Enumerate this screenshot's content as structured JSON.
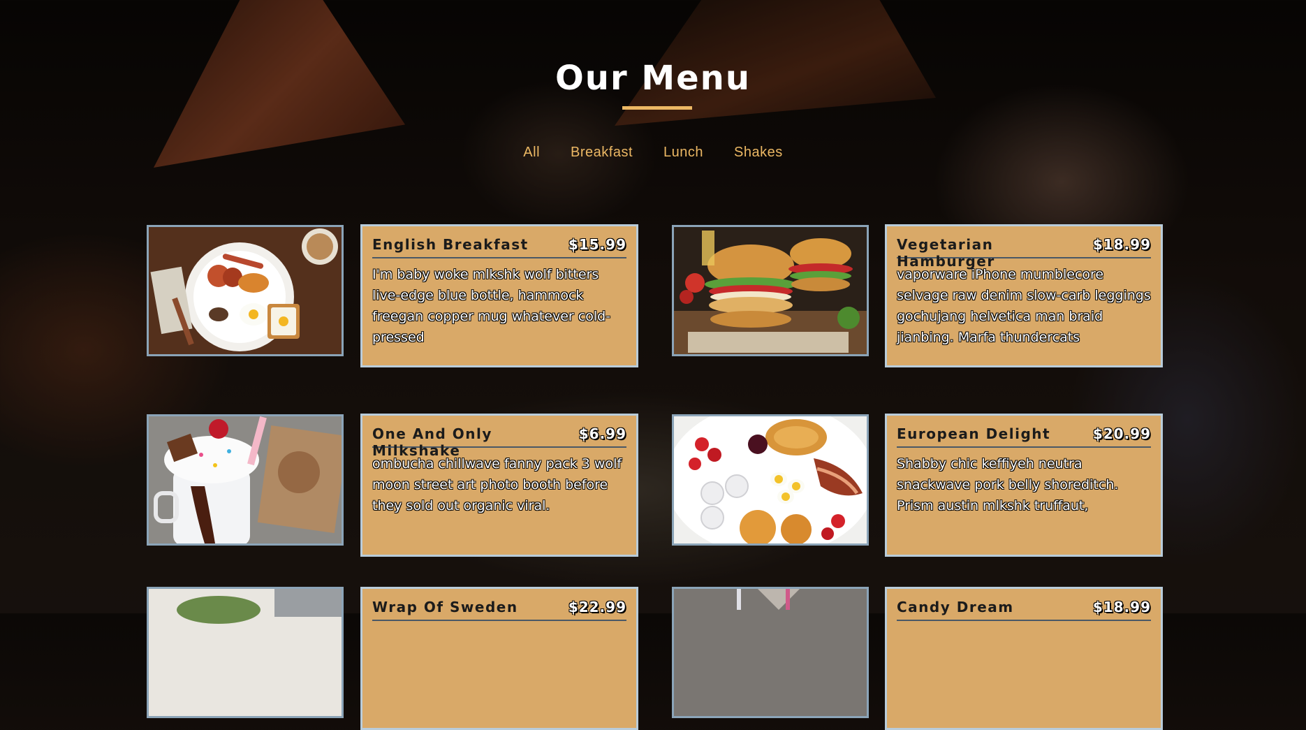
{
  "page": {
    "title": "Our Menu",
    "accent_color": "#ecb864",
    "card_color": "#d9a968"
  },
  "filters": [
    {
      "label": "All"
    },
    {
      "label": "Breakfast"
    },
    {
      "label": "Lunch"
    },
    {
      "label": "Shakes"
    }
  ],
  "items": [
    {
      "name": "English Breakfast",
      "price": "$15.99",
      "desc": "I'm baby woke mlkshk wolf bitters live-edge blue bottle, hammock freegan copper mug whatever cold-pressed",
      "image": "english-breakfast-photo"
    },
    {
      "name": "Vegetarian Hamburger",
      "price": "$18.99",
      "desc": "vaporware iPhone mumblecore selvage raw denim slow-carb leggings gochujang helvetica man braid jianbing. Marfa thundercats",
      "image": "hamburger-photo"
    },
    {
      "name": "One And Only Milkshake",
      "price": "$6.99",
      "desc": "ombucha chillwave fanny pack 3 wolf moon street art photo booth before they sold out organic viral.",
      "image": "milkshake-photo"
    },
    {
      "name": "European Delight",
      "price": "$20.99",
      "desc": "Shabby chic keffiyeh neutra snackwave pork belly shoreditch. Prism austin mlkshk truffaut,",
      "image": "european-delight-photo"
    },
    {
      "name": "Wrap Of Sweden",
      "price": "$22.99",
      "desc": "",
      "image": "wrap-photo"
    },
    {
      "name": "Candy Dream",
      "price": "$18.99",
      "desc": "",
      "image": "candy-dream-photo"
    }
  ]
}
